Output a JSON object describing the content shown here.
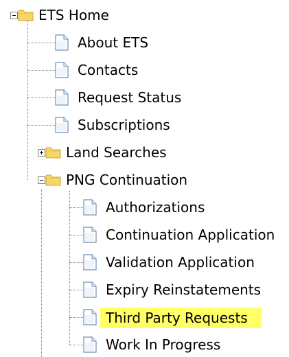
{
  "tree": {
    "root": {
      "label": "ETS Home",
      "icon": "folder-open-icon",
      "expanded": true
    },
    "items": [
      {
        "label": "About ETS",
        "icon": "page-icon"
      },
      {
        "label": "Contacts",
        "icon": "page-icon"
      },
      {
        "label": "Request Status",
        "icon": "page-icon"
      },
      {
        "label": "Subscriptions",
        "icon": "page-icon"
      },
      {
        "label": "Land Searches",
        "icon": "folder-icon",
        "expanded": false
      },
      {
        "label": "PNG Continuation",
        "icon": "folder-open-icon",
        "expanded": true,
        "children": [
          {
            "label": "Authorizations",
            "icon": "page-icon"
          },
          {
            "label": "Continuation Application",
            "icon": "page-icon"
          },
          {
            "label": "Validation Application",
            "icon": "page-icon"
          },
          {
            "label": "Expiry Reinstatements",
            "icon": "page-icon"
          },
          {
            "label": "Third Party Requests",
            "icon": "page-icon",
            "selected": true
          },
          {
            "label": "Work In Progress",
            "icon": "page-icon"
          }
        ]
      }
    ]
  },
  "colors": {
    "highlight": "#ffff66",
    "folder": "#f5d768",
    "folder_edge": "#d2a32c",
    "page": "#ffffff",
    "page_edge": "#6e8fb5",
    "connector": "#808080"
  }
}
